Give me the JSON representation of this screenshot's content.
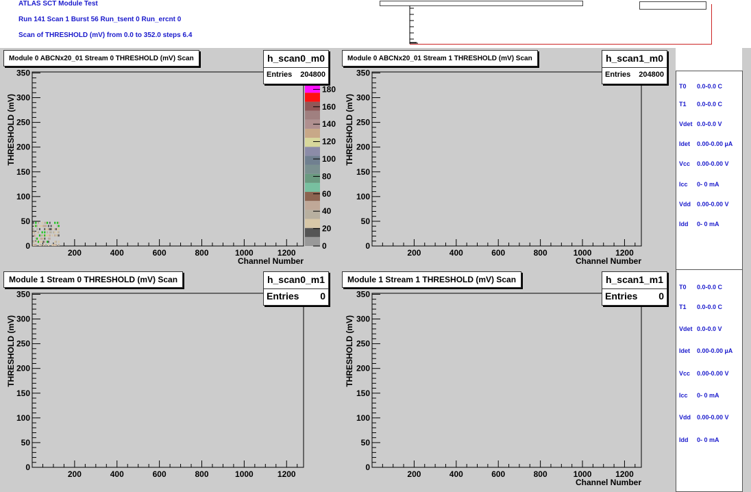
{
  "header": {
    "title": "ATLAS SCT Module Test",
    "run_line": "Run 141  Scan 1  Burst 56  Run_tsent 0  Run_ercnt 0",
    "scan_line": "Scan of THRESHOLD (mV) from 0.0 to 352.0 steps 6.4"
  },
  "panels": [
    {
      "title": "Module 0 ABCNx20_01 Stream 0 THRESHOLD (mV) Scan",
      "hist_name": "h_scan0_m0",
      "entries_label": "Entries",
      "entries": "204800"
    },
    {
      "title": "Module 0 ABCNx20_01 Stream 1 THRESHOLD (mV) Scan",
      "hist_name": "h_scan1_m0",
      "entries_label": "Entries",
      "entries": "204800"
    },
    {
      "title": "Module 1    Stream 0 THRESHOLD (mV) Scan",
      "hist_name": "h_scan0_m1",
      "entries_label": "Entries",
      "entries": "0"
    },
    {
      "title": "Module 1    Stream 1 THRESHOLD (mV) Scan",
      "hist_name": "h_scan1_m1",
      "entries_label": "Entries",
      "entries": "0"
    }
  ],
  "info_panels": [
    {
      "rows": [
        {
          "label": "T0",
          "value": "0.0-0.0 C"
        },
        {
          "label": "T1",
          "value": "0.0-0.0 C"
        },
        {
          "label": "Vdet",
          "value": "0.0-0.0 V"
        },
        {
          "label": "Idet",
          "value": "0.00-0.00 µA"
        },
        {
          "label": "Vcc",
          "value": "0.00-0.00 V"
        },
        {
          "label": "Icc",
          "value": "0-   0 mA"
        },
        {
          "label": "Vdd",
          "value": "0.00-0.00 V"
        },
        {
          "label": "Idd",
          "value": "0-   0 mA"
        }
      ]
    },
    {
      "rows": [
        {
          "label": "T0",
          "value": "0.0-0.0 C"
        },
        {
          "label": "T1",
          "value": "0.0-0.0 C"
        },
        {
          "label": "Vdet",
          "value": "0.0-0.0 V"
        },
        {
          "label": "Idet",
          "value": "0.00-0.00 µA"
        },
        {
          "label": "Vcc",
          "value": "0.00-0.00 V"
        },
        {
          "label": "Icc",
          "value": "0-   0 mA"
        },
        {
          "label": "Vdd",
          "value": "0.00-0.00 V"
        },
        {
          "label": "Idd",
          "value": "0-   0 mA"
        }
      ]
    }
  ],
  "colors": {
    "frame_bg": "#cccccc",
    "text_blue": "#1a1acc",
    "plot_bg": "#cccccc"
  },
  "chart_data": [
    {
      "type": "heatmap",
      "xlabel": "Channel Number",
      "ylabel": "THRESHOLD (mV)",
      "xlim": [
        0,
        1280
      ],
      "ylim": [
        0,
        352
      ],
      "xticks": [
        200,
        400,
        600,
        800,
        1000,
        1200
      ],
      "yticks": [
        0,
        50,
        100,
        150,
        200,
        250,
        300,
        350
      ],
      "populated_region": {
        "x": [
          0,
          128
        ],
        "y": [
          0,
          45
        ]
      },
      "zlim": [
        0,
        200
      ],
      "zticks": [
        0,
        20,
        40,
        60,
        80,
        100,
        120,
        140,
        160,
        180
      ],
      "palette": [
        "#999999",
        "#555555",
        "#d8c8a8",
        "#b8b0a0",
        "#c0a898",
        "#8c6450",
        "#78c0a0",
        "#6a9a80",
        "#7a9090",
        "#708090",
        "#8c8ca8",
        "#d8d89c",
        "#c8a888",
        "#b09090",
        "#a08080",
        "#905858",
        "#ff1010",
        "#ff10ff",
        "#10c010"
      ]
    },
    {
      "type": "heatmap",
      "xlabel": "Channel Number",
      "ylabel": "THRESHOLD (mV)",
      "xlim": [
        0,
        1280
      ],
      "ylim": [
        0,
        352
      ],
      "xticks": [
        200,
        400,
        600,
        800,
        1000,
        1200
      ],
      "yticks": [
        0,
        50,
        100,
        150,
        200,
        250,
        300,
        350
      ]
    },
    {
      "type": "heatmap",
      "xlabel": "",
      "ylabel": "THRESHOLD (mV)",
      "xlim": [
        0,
        1280
      ],
      "ylim": [
        0,
        352
      ],
      "xticks": [
        200,
        400,
        600,
        800,
        1000,
        1200
      ],
      "yticks": [
        0,
        50,
        100,
        150,
        200,
        250,
        300,
        350
      ]
    },
    {
      "type": "heatmap",
      "xlabel": "Channel Number",
      "ylabel": "THRESHOLD (mV)",
      "xlim": [
        0,
        1280
      ],
      "ylim": [
        0,
        352
      ],
      "xticks": [
        200,
        400,
        600,
        800,
        1000,
        1200
      ],
      "yticks": [
        0,
        50,
        100,
        150,
        200,
        250,
        300,
        350
      ]
    }
  ]
}
